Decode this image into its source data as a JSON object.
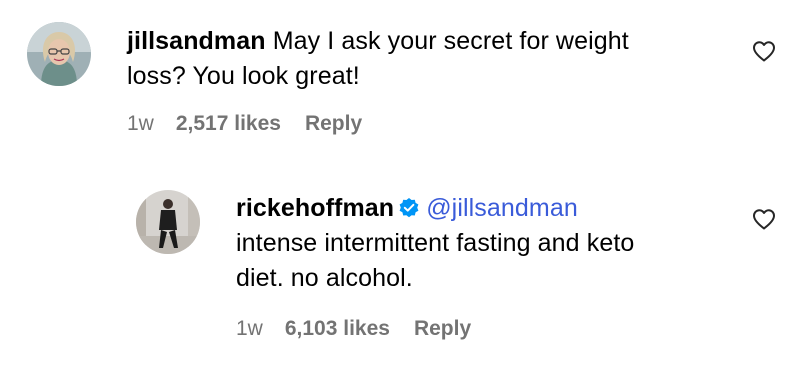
{
  "comments": [
    {
      "username": "jillsandman",
      "text_line1": "May I ask your secret for weight",
      "text_line2": "loss? You look great!",
      "time": "1w",
      "likes": "2,517 likes",
      "reply_label": "Reply",
      "verified": false,
      "avatar_icon": "profile-photo-woman-glasses",
      "like_icon": "heart-outline-icon"
    },
    {
      "username": "rickehoffman",
      "mention": "@jillsandman",
      "text_line1": "intense intermittent fasting and keto",
      "text_line2": "diet. no alcohol.",
      "time": "1w",
      "likes": "6,103 likes",
      "reply_label": "Reply",
      "verified": true,
      "avatar_icon": "profile-photo-man-walking",
      "like_icon": "heart-outline-icon"
    }
  ],
  "colors": {
    "text": "#000000",
    "meta": "#737373",
    "mention": "#3a5bd9",
    "verified_badge": "#0095f6"
  }
}
